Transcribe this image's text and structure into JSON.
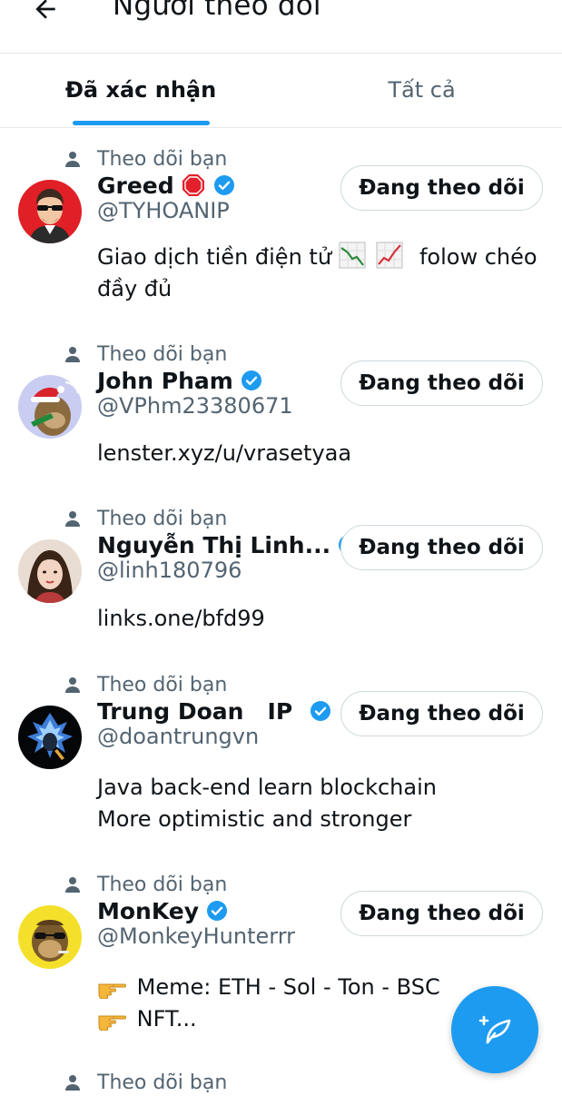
{
  "header": {
    "title": "Người theo dõi"
  },
  "tabs": [
    {
      "label": "Đã xác nhận",
      "active": true
    },
    {
      "label": "Tất cả",
      "active": false
    }
  ],
  "colors": {
    "accent": "#1d9bf0",
    "secondary_text": "#536471",
    "verified": "#1d9bf0"
  },
  "follows_you_label": "Theo dõi bạn",
  "button_label": "Đang theo dõi",
  "users": [
    {
      "name": "Greed",
      "handle": "@TYHOANIP",
      "verified": true,
      "name_emoji": "stop-sign-icon",
      "bio_prefix": "Giao dịch tiền điện tử",
      "bio_emojis": [
        "chart-decreasing-icon",
        "chart-increasing-icon"
      ],
      "bio_suffix": "folow chéo",
      "bio_line2": "đầy đủ"
    },
    {
      "name": "John Pham",
      "handle": "@VPhm23380671",
      "verified": true,
      "bio_line1": "lenster.xyz/u/vrasetyaa"
    },
    {
      "name": "Nguyễn Thị Linh...",
      "handle": "@linh180796",
      "verified": true,
      "bio_line1": "links.one/bfd99"
    },
    {
      "name": "Trung Doan   IP",
      "handle": "@doantrungvn",
      "verified": true,
      "bio_line1": "Java back-end learn blockchain",
      "bio_line2": "More optimistic and stronger"
    },
    {
      "name": "MonKey",
      "handle": "@MonkeyHunterrr",
      "verified": true,
      "bio_emoji": "pointing-hand-icon",
      "bio_line1": "Meme: ETH -  Sol - Ton  - BSC",
      "bio_line2": "NFT..."
    }
  ],
  "partial_item": {
    "follows_you": "Theo dõi bạn"
  },
  "fab": {
    "icon": "compose-tweet-icon"
  }
}
